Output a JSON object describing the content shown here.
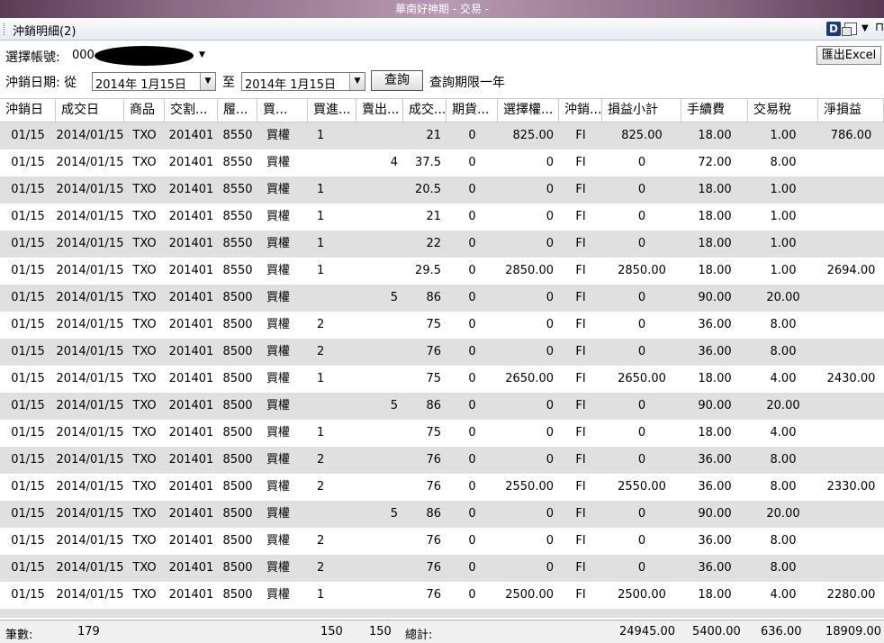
{
  "window": {
    "title": "華南好神期 - 交易 -"
  },
  "panel": {
    "title": "沖銷明細(2)"
  },
  "toolbar": {
    "account_label": "選擇帳號:",
    "account_prefix": "000-",
    "excel_button": "匯出Excel",
    "date_label": "沖銷日期: 從",
    "date_from": "2014年  1月15日",
    "to_label": "至",
    "date_to": "2014年  1月15日",
    "query_button": "查詢",
    "query_note": "查詢期限一年"
  },
  "table": {
    "columns": [
      "沖銷日",
      "成交日",
      "商品",
      "交割...",
      "履...",
      "買...",
      "買進...",
      "賣出...",
      "成交...",
      "期貨...",
      "選擇權...",
      "沖銷...",
      "損益小計",
      "手續費",
      "交易稅",
      "淨損益"
    ],
    "rows": [
      [
        "01/15",
        "2014/01/15",
        "TXO",
        "201401",
        "8550",
        "買權",
        "1",
        "",
        "21",
        "0",
        "825.00",
        "FI",
        "825.00",
        "18.00",
        "1.00",
        "786.00"
      ],
      [
        "01/15",
        "2014/01/15",
        "TXO",
        "201401",
        "8550",
        "買權",
        "",
        "4",
        "37.5",
        "0",
        "0",
        "FI",
        "0",
        "72.00",
        "8.00",
        ""
      ],
      [
        "01/15",
        "2014/01/15",
        "TXO",
        "201401",
        "8550",
        "買權",
        "1",
        "",
        "20.5",
        "0",
        "0",
        "FI",
        "0",
        "18.00",
        "1.00",
        ""
      ],
      [
        "01/15",
        "2014/01/15",
        "TXO",
        "201401",
        "8550",
        "買權",
        "1",
        "",
        "21",
        "0",
        "0",
        "FI",
        "0",
        "18.00",
        "1.00",
        ""
      ],
      [
        "01/15",
        "2014/01/15",
        "TXO",
        "201401",
        "8550",
        "買權",
        "1",
        "",
        "22",
        "0",
        "0",
        "FI",
        "0",
        "18.00",
        "1.00",
        ""
      ],
      [
        "01/15",
        "2014/01/15",
        "TXO",
        "201401",
        "8550",
        "買權",
        "1",
        "",
        "29.5",
        "0",
        "2850.00",
        "FI",
        "2850.00",
        "18.00",
        "1.00",
        "2694.00"
      ],
      [
        "01/15",
        "2014/01/15",
        "TXO",
        "201401",
        "8500",
        "買權",
        "",
        "5",
        "86",
        "0",
        "0",
        "FI",
        "0",
        "90.00",
        "20.00",
        ""
      ],
      [
        "01/15",
        "2014/01/15",
        "TXO",
        "201401",
        "8500",
        "買權",
        "2",
        "",
        "75",
        "0",
        "0",
        "FI",
        "0",
        "36.00",
        "8.00",
        ""
      ],
      [
        "01/15",
        "2014/01/15",
        "TXO",
        "201401",
        "8500",
        "買權",
        "2",
        "",
        "76",
        "0",
        "0",
        "FI",
        "0",
        "36.00",
        "8.00",
        ""
      ],
      [
        "01/15",
        "2014/01/15",
        "TXO",
        "201401",
        "8500",
        "買權",
        "1",
        "",
        "75",
        "0",
        "2650.00",
        "FI",
        "2650.00",
        "18.00",
        "4.00",
        "2430.00"
      ],
      [
        "01/15",
        "2014/01/15",
        "TXO",
        "201401",
        "8500",
        "買權",
        "",
        "5",
        "86",
        "0",
        "0",
        "FI",
        "0",
        "90.00",
        "20.00",
        ""
      ],
      [
        "01/15",
        "2014/01/15",
        "TXO",
        "201401",
        "8500",
        "買權",
        "1",
        "",
        "75",
        "0",
        "0",
        "FI",
        "0",
        "18.00",
        "4.00",
        ""
      ],
      [
        "01/15",
        "2014/01/15",
        "TXO",
        "201401",
        "8500",
        "買權",
        "2",
        "",
        "76",
        "0",
        "0",
        "FI",
        "0",
        "36.00",
        "8.00",
        ""
      ],
      [
        "01/15",
        "2014/01/15",
        "TXO",
        "201401",
        "8500",
        "買權",
        "2",
        "",
        "76",
        "0",
        "2550.00",
        "FI",
        "2550.00",
        "36.00",
        "8.00",
        "2330.00"
      ],
      [
        "01/15",
        "2014/01/15",
        "TXO",
        "201401",
        "8500",
        "買權",
        "",
        "5",
        "86",
        "0",
        "0",
        "FI",
        "0",
        "90.00",
        "20.00",
        ""
      ],
      [
        "01/15",
        "2014/01/15",
        "TXO",
        "201401",
        "8500",
        "買權",
        "2",
        "",
        "76",
        "0",
        "0",
        "FI",
        "0",
        "36.00",
        "8.00",
        ""
      ],
      [
        "01/15",
        "2014/01/15",
        "TXO",
        "201401",
        "8500",
        "買權",
        "2",
        "",
        "76",
        "0",
        "0",
        "FI",
        "0",
        "36.00",
        "8.00",
        ""
      ],
      [
        "01/15",
        "2014/01/15",
        "TXO",
        "201401",
        "8500",
        "買權",
        "1",
        "",
        "76",
        "0",
        "2500.00",
        "FI",
        "2500.00",
        "18.00",
        "4.00",
        "2280.00"
      ]
    ]
  },
  "footer": {
    "count_label": "筆數:",
    "count": "179",
    "buy_total": "150",
    "sell_total": "150",
    "total_label": "總計:",
    "pl_total": "24945.00",
    "fee_total": "5400.00",
    "tax_total": "636.00",
    "net_total": "18909.00"
  }
}
